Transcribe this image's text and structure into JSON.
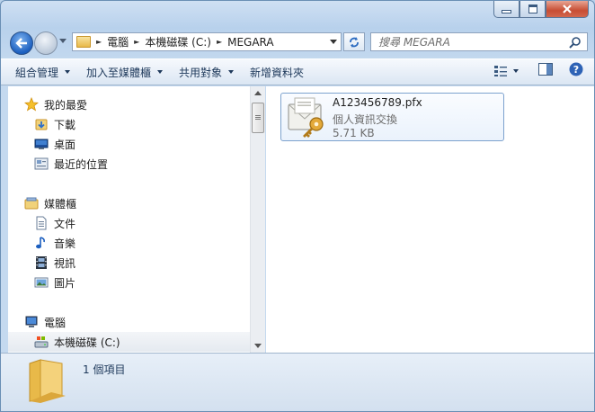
{
  "window": {
    "buttons": {
      "minimize_icon": "minimize-icon",
      "maximize_icon": "maximize-icon",
      "close_icon": "close-icon"
    }
  },
  "address": {
    "crumbs": [
      "電腦",
      "本機磁碟 (C:)",
      "MEGARA"
    ]
  },
  "search": {
    "placeholder": "搜尋 MEGARA"
  },
  "toolbar": {
    "organize": "組合管理",
    "include": "加入至媒體櫃",
    "share": "共用對象",
    "new_folder": "新增資料夾"
  },
  "nav": {
    "favorites": {
      "label": "我的最愛",
      "items": [
        "下載",
        "桌面",
        "最近的位置"
      ]
    },
    "libraries": {
      "label": "媒體櫃",
      "items": [
        "文件",
        "音樂",
        "視訊",
        "圖片"
      ]
    },
    "computer": {
      "label": "電腦",
      "items": [
        "本機磁碟 (C:)"
      ]
    }
  },
  "file": {
    "name": "A123456789.pfx",
    "type": "個人資訊交換",
    "size": "5.71 KB"
  },
  "status": {
    "count": "1 個項目"
  },
  "colors": {
    "accent": "#1c5fbf",
    "tile_border": "#7da2ce",
    "close": "#c74d33"
  }
}
